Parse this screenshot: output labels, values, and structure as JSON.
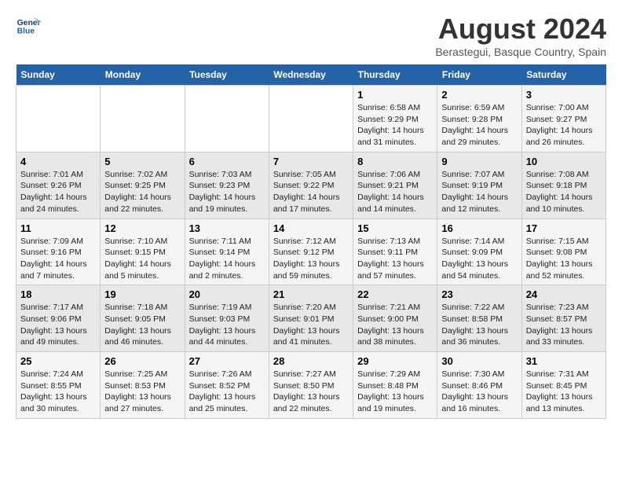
{
  "header": {
    "logo_line1": "General",
    "logo_line2": "Blue",
    "title": "August 2024",
    "subtitle": "Berastegui, Basque Country, Spain"
  },
  "weekdays": [
    "Sunday",
    "Monday",
    "Tuesday",
    "Wednesday",
    "Thursday",
    "Friday",
    "Saturday"
  ],
  "weeks": [
    [
      {
        "day": "",
        "info": ""
      },
      {
        "day": "",
        "info": ""
      },
      {
        "day": "",
        "info": ""
      },
      {
        "day": "",
        "info": ""
      },
      {
        "day": "1",
        "info": "Sunrise: 6:58 AM\nSunset: 9:29 PM\nDaylight: 14 hours\nand 31 minutes."
      },
      {
        "day": "2",
        "info": "Sunrise: 6:59 AM\nSunset: 9:28 PM\nDaylight: 14 hours\nand 29 minutes."
      },
      {
        "day": "3",
        "info": "Sunrise: 7:00 AM\nSunset: 9:27 PM\nDaylight: 14 hours\nand 26 minutes."
      }
    ],
    [
      {
        "day": "4",
        "info": "Sunrise: 7:01 AM\nSunset: 9:26 PM\nDaylight: 14 hours\nand 24 minutes."
      },
      {
        "day": "5",
        "info": "Sunrise: 7:02 AM\nSunset: 9:25 PM\nDaylight: 14 hours\nand 22 minutes."
      },
      {
        "day": "6",
        "info": "Sunrise: 7:03 AM\nSunset: 9:23 PM\nDaylight: 14 hours\nand 19 minutes."
      },
      {
        "day": "7",
        "info": "Sunrise: 7:05 AM\nSunset: 9:22 PM\nDaylight: 14 hours\nand 17 minutes."
      },
      {
        "day": "8",
        "info": "Sunrise: 7:06 AM\nSunset: 9:21 PM\nDaylight: 14 hours\nand 14 minutes."
      },
      {
        "day": "9",
        "info": "Sunrise: 7:07 AM\nSunset: 9:19 PM\nDaylight: 14 hours\nand 12 minutes."
      },
      {
        "day": "10",
        "info": "Sunrise: 7:08 AM\nSunset: 9:18 PM\nDaylight: 14 hours\nand 10 minutes."
      }
    ],
    [
      {
        "day": "11",
        "info": "Sunrise: 7:09 AM\nSunset: 9:16 PM\nDaylight: 14 hours\nand 7 minutes."
      },
      {
        "day": "12",
        "info": "Sunrise: 7:10 AM\nSunset: 9:15 PM\nDaylight: 14 hours\nand 5 minutes."
      },
      {
        "day": "13",
        "info": "Sunrise: 7:11 AM\nSunset: 9:14 PM\nDaylight: 14 hours\nand 2 minutes."
      },
      {
        "day": "14",
        "info": "Sunrise: 7:12 AM\nSunset: 9:12 PM\nDaylight: 13 hours\nand 59 minutes."
      },
      {
        "day": "15",
        "info": "Sunrise: 7:13 AM\nSunset: 9:11 PM\nDaylight: 13 hours\nand 57 minutes."
      },
      {
        "day": "16",
        "info": "Sunrise: 7:14 AM\nSunset: 9:09 PM\nDaylight: 13 hours\nand 54 minutes."
      },
      {
        "day": "17",
        "info": "Sunrise: 7:15 AM\nSunset: 9:08 PM\nDaylight: 13 hours\nand 52 minutes."
      }
    ],
    [
      {
        "day": "18",
        "info": "Sunrise: 7:17 AM\nSunset: 9:06 PM\nDaylight: 13 hours\nand 49 minutes."
      },
      {
        "day": "19",
        "info": "Sunrise: 7:18 AM\nSunset: 9:05 PM\nDaylight: 13 hours\nand 46 minutes."
      },
      {
        "day": "20",
        "info": "Sunrise: 7:19 AM\nSunset: 9:03 PM\nDaylight: 13 hours\nand 44 minutes."
      },
      {
        "day": "21",
        "info": "Sunrise: 7:20 AM\nSunset: 9:01 PM\nDaylight: 13 hours\nand 41 minutes."
      },
      {
        "day": "22",
        "info": "Sunrise: 7:21 AM\nSunset: 9:00 PM\nDaylight: 13 hours\nand 38 minutes."
      },
      {
        "day": "23",
        "info": "Sunrise: 7:22 AM\nSunset: 8:58 PM\nDaylight: 13 hours\nand 36 minutes."
      },
      {
        "day": "24",
        "info": "Sunrise: 7:23 AM\nSunset: 8:57 PM\nDaylight: 13 hours\nand 33 minutes."
      }
    ],
    [
      {
        "day": "25",
        "info": "Sunrise: 7:24 AM\nSunset: 8:55 PM\nDaylight: 13 hours\nand 30 minutes."
      },
      {
        "day": "26",
        "info": "Sunrise: 7:25 AM\nSunset: 8:53 PM\nDaylight: 13 hours\nand 27 minutes."
      },
      {
        "day": "27",
        "info": "Sunrise: 7:26 AM\nSunset: 8:52 PM\nDaylight: 13 hours\nand 25 minutes."
      },
      {
        "day": "28",
        "info": "Sunrise: 7:27 AM\nSunset: 8:50 PM\nDaylight: 13 hours\nand 22 minutes."
      },
      {
        "day": "29",
        "info": "Sunrise: 7:29 AM\nSunset: 8:48 PM\nDaylight: 13 hours\nand 19 minutes."
      },
      {
        "day": "30",
        "info": "Sunrise: 7:30 AM\nSunset: 8:46 PM\nDaylight: 13 hours\nand 16 minutes."
      },
      {
        "day": "31",
        "info": "Sunrise: 7:31 AM\nSunset: 8:45 PM\nDaylight: 13 hours\nand 13 minutes."
      }
    ]
  ]
}
